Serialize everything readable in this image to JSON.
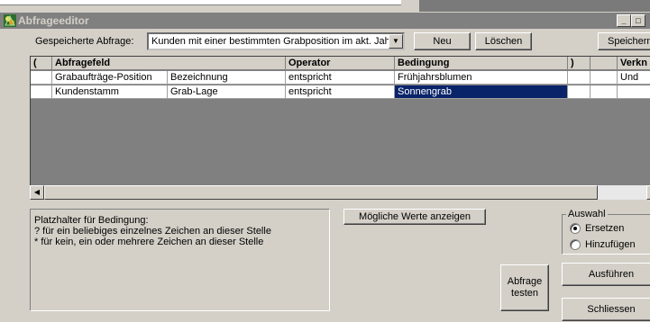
{
  "window": {
    "title": "Abfrageeditor"
  },
  "query": {
    "label": "Gespeicherte Abfrage:",
    "selected": "Kunden mit einer bestimmten Grabposition im akt. Jahr",
    "btn_new": "Neu",
    "btn_delete": "Löschen",
    "btn_save": "Speichern"
  },
  "grid": {
    "headers": {
      "open_paren": "(",
      "field": "Abfragefeld",
      "operator": "Operator",
      "condition": "Bedingung",
      "close_paren": ")",
      "link": "Verkn"
    },
    "rows": [
      {
        "table": "Grabaufträge-Position",
        "field": "Bezeichnung",
        "operator": "entspricht",
        "condition": "Frühjahrsblumen",
        "link": "Und"
      },
      {
        "table": "Kundenstamm",
        "field": "Grab-Lage",
        "operator": "entspricht",
        "condition": "Sonnengrab",
        "link": ""
      }
    ]
  },
  "hint": {
    "line1": "Platzhalter für Bedingung:",
    "line2": "? für ein beliebiges einzelnes Zeichen an dieser Stelle",
    "line3": "* für kein, ein oder mehrere Zeichen an dieser Stelle"
  },
  "buttons": {
    "possible_values": "Mögliche Werte anzeigen",
    "test_query": "Abfrage testen",
    "execute": "Ausführen",
    "close": "Schliessen"
  },
  "selection": {
    "label": "Auswahl",
    "replace": "Ersetzen",
    "add": "Hinzufügen",
    "selected": "replace"
  },
  "colors": {
    "face": "#d4d0c8",
    "titlebar_inactive": "#808080",
    "selection": "#0a246a"
  }
}
